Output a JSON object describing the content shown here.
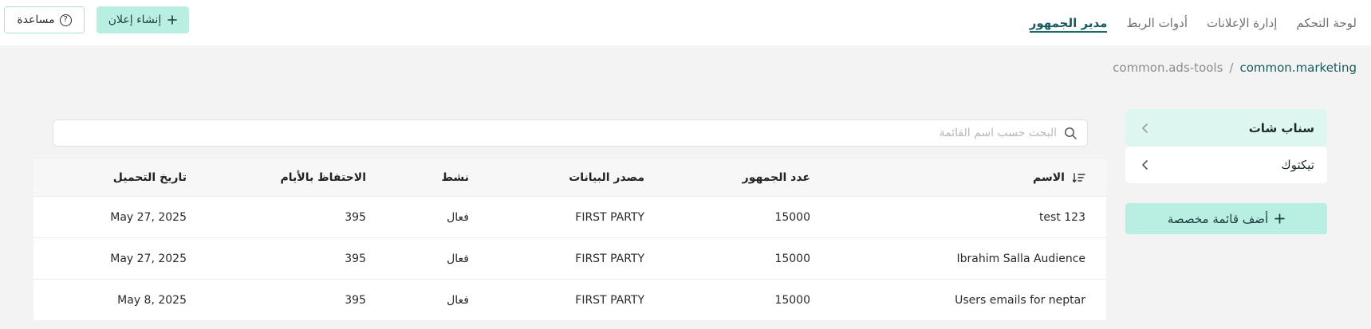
{
  "nav": {
    "tabs": [
      {
        "label": "لوحة التحكم",
        "active": false
      },
      {
        "label": "إدارة الإعلانات",
        "active": false
      },
      {
        "label": "أدوات الربط",
        "active": false
      },
      {
        "label": "مدير الجمهور",
        "active": true
      }
    ],
    "create_ad_label": "إنشاء إعلان",
    "help_label": "مساعدة"
  },
  "breadcrumb": {
    "parent": "common.ads-tools",
    "separator": "/",
    "current": "common.marketing"
  },
  "sidebar": {
    "items": [
      {
        "label": "سناب شات",
        "active": true
      },
      {
        "label": "تيكتوك",
        "active": false
      }
    ],
    "add_list_label": "أضف قائمة مخصصة"
  },
  "search": {
    "placeholder": "البحث حسب اسم القائمة",
    "value": ""
  },
  "table": {
    "headers": {
      "name": "الاسم",
      "audience_count": "عدد الجمهور",
      "data_source": "مصدر البيانات",
      "active": "نشط",
      "retention_days": "الاحتفاظ بالأيام",
      "upload_date": "تاريخ التحميل"
    },
    "rows": [
      {
        "name": "test 123",
        "audience_count": "15000",
        "data_source": "FIRST PARTY",
        "active": "فعال",
        "retention_days": "395",
        "upload_date": "May 27, 2025"
      },
      {
        "name": "Ibrahim Salla Audience",
        "audience_count": "15000",
        "data_source": "FIRST PARTY",
        "active": "فعال",
        "retention_days": "395",
        "upload_date": "May 27, 2025"
      },
      {
        "name": "Users emails for neptar",
        "audience_count": "15000",
        "data_source": "FIRST PARTY",
        "active": "فعال",
        "retention_days": "395",
        "upload_date": "May 8, 2025"
      }
    ]
  },
  "colors": {
    "accent": "#b9efe3",
    "active_sidebar": "#ddf6ef",
    "active_tab": "#1a5a5e"
  }
}
